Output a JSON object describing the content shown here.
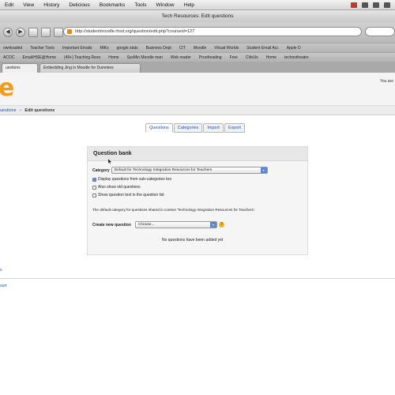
{
  "menubar": {
    "items": [
      "Edit",
      "View",
      "History",
      "Delicious",
      "Bookmarks",
      "Tools",
      "Window",
      "Help"
    ]
  },
  "window": {
    "title": "Tech Resources: Edit questions"
  },
  "browser": {
    "url": "http://studentmoodle.rhsd.org/question/edit.php?courseid=127"
  },
  "bookmarks_row1": [
    "ownloaded",
    "Teacher Tools",
    "Important Emails",
    "MiKs",
    "google stats",
    "Business Dept",
    "CIT",
    "Moodle",
    "Virtual Worlds",
    "Student Email Acc",
    "Apple D"
  ],
  "bookmarks_row2": [
    "ACOC",
    "Email/HSE@Home",
    "(49+) Teaching Reso",
    "Home",
    "SysMin Moodle man",
    "Web reader",
    "Proofreading",
    "Free",
    "ClitsUs",
    "Home",
    "technotheatre"
  ],
  "tabs": [
    {
      "label": "uestions"
    },
    {
      "label": "Embedding Jing in Moodle for Dummies"
    }
  ],
  "header": {
    "user_text": "You are"
  },
  "breadcrumb": {
    "parent": "uestions",
    "current": "Edit questions"
  },
  "question_tabs": [
    "Questions",
    "Categories",
    "Import",
    "Export"
  ],
  "qbank": {
    "title": "Question bank",
    "category_label": "Category",
    "category_value": "Default for Technology Integration Resources for Teachers",
    "options": [
      {
        "label": "Display questions from sub-categories too",
        "checked": true
      },
      {
        "label": "Also show old questions",
        "checked": false
      },
      {
        "label": "Show question text in the question list",
        "checked": false
      }
    ],
    "description": "The default category for questions shared in context 'Technology Integration Resources for Teachers'.",
    "create_label": "Create new question",
    "create_value": "Choose...",
    "empty_text": "No questions have been added yet"
  },
  "side": {
    "link1": "s",
    "link2": "ourt"
  }
}
